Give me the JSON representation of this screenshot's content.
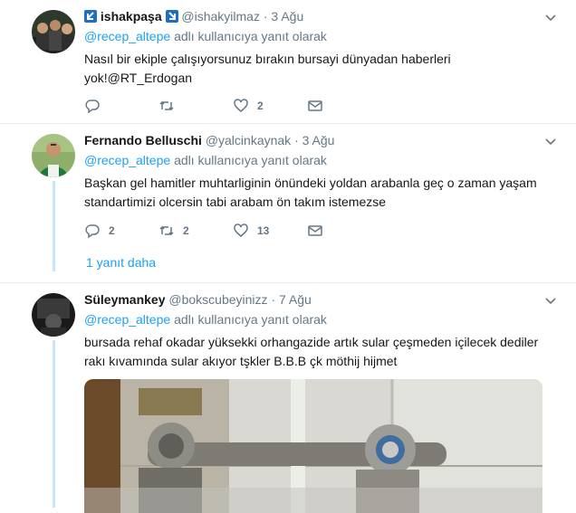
{
  "tweets": [
    {
      "name": "ishakpaşa",
      "handle": "@ishakyilmaz",
      "dot": "·",
      "date": "3 Ağu",
      "reply_prefix_mention": "@recep_altepe",
      "reply_suffix": "adlı kullanıcıya yanıt olarak",
      "text": "Nasıl bir ekiple çalışıyorsunuz bırakın bursayi dünyadan haberleri yok!@RT_Erdogan",
      "replies": "",
      "retweets": "",
      "likes": "2"
    },
    {
      "name": "Fernando Belluschi",
      "handle": "@yalcinkaynak",
      "dot": "·",
      "date": "3 Ağu",
      "reply_prefix_mention": "@recep_altepe",
      "reply_suffix": "adlı kullanıcıya yanıt olarak",
      "text": "Başkan gel hamitler muhtarliginin önündeki yoldan arabanla geç o zaman yaşam standartimizi olcersin tabi arabam ön takım istemezse",
      "replies": "2",
      "retweets": "2",
      "likes": "13",
      "more_replies": "1 yanıt daha"
    },
    {
      "name": "Süleymankey",
      "handle": "@bokscubeyinizz",
      "dot": "·",
      "date": "7 Ağu",
      "reply_prefix_mention": "@recep_altepe",
      "reply_suffix": "adlı kullanıcıya yanıt olarak",
      "text": "bursada rehaf okadar yüksekki orhangazide artık sular çeşmeden içilecek dediler rakı kıvamında sular akıyor tşkler B.B.B  çk möthij hijmet"
    }
  ],
  "icons": [
    "reply-icon",
    "retweet-icon",
    "like-icon",
    "message-icon",
    "caret-down-icon",
    "arrow-badge-icon"
  ],
  "colors": {
    "link": "#1da1f2",
    "muted": "#657786",
    "thread": "#c7e6fb",
    "divider": "#e6ecf0"
  }
}
